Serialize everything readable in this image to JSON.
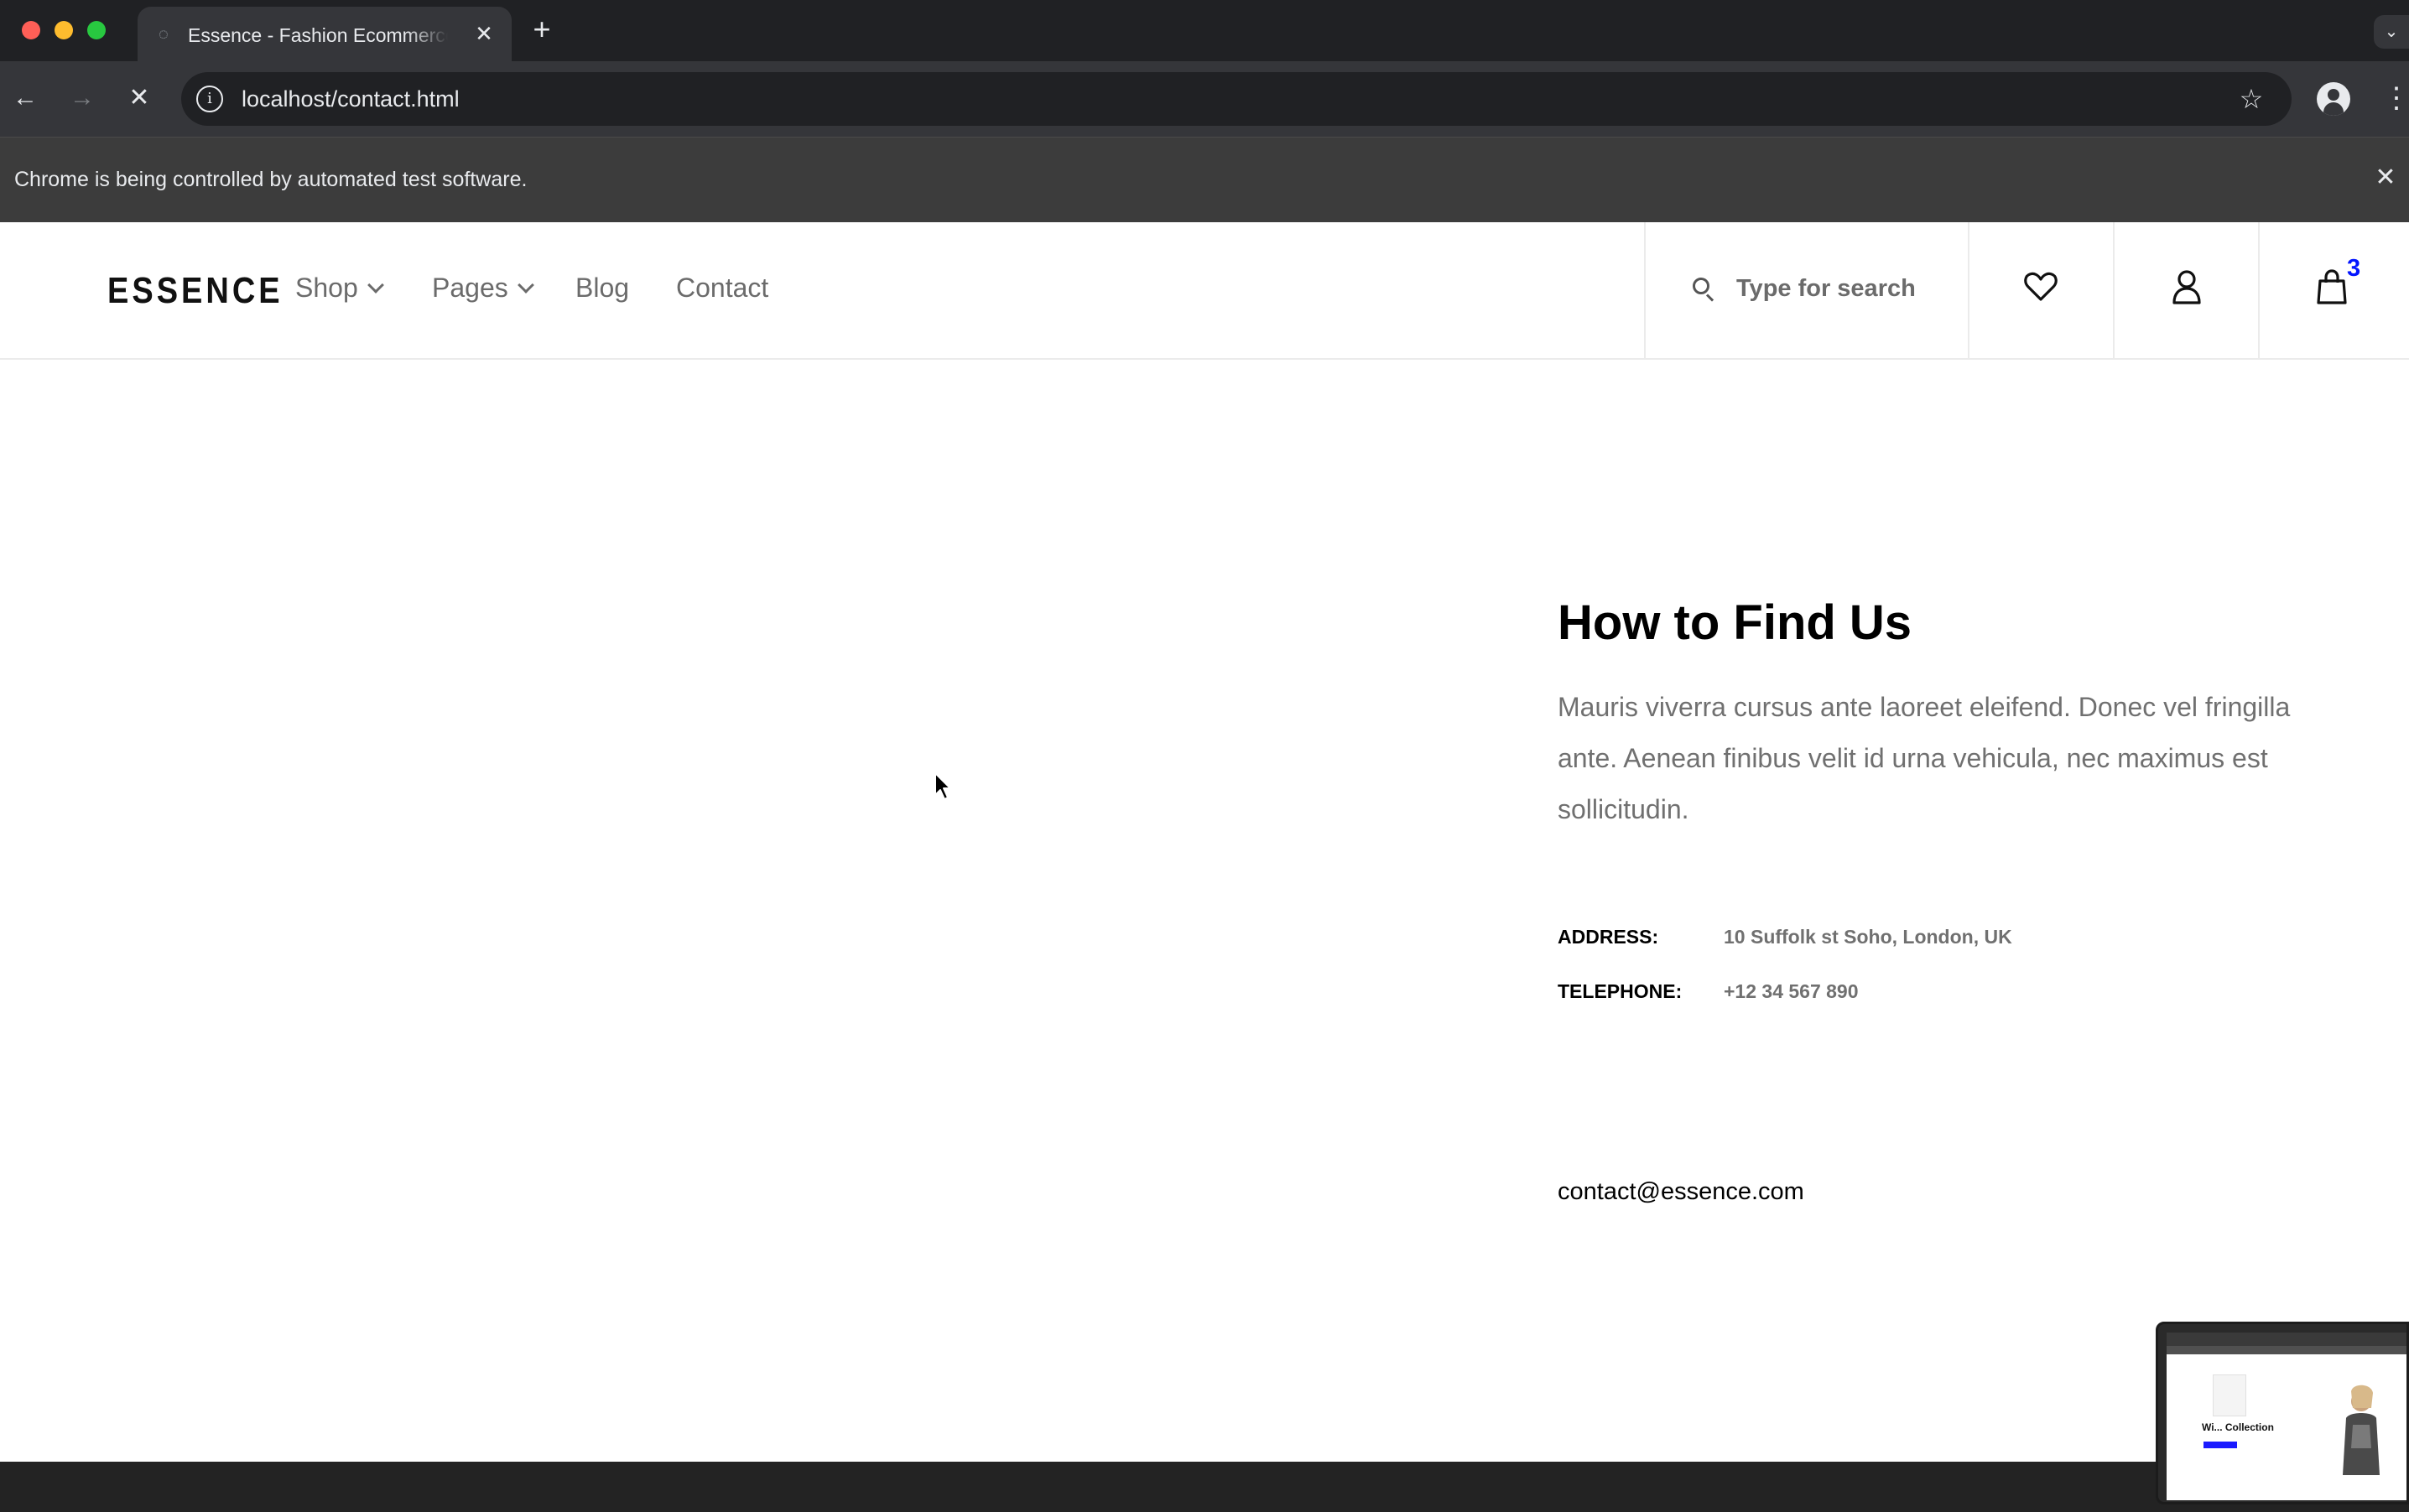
{
  "browser": {
    "tab_title": "Essence - Fashion Ecommerce Template",
    "tab_close_glyph": "✕",
    "new_tab_glyph": "+",
    "url": "localhost/contact.html",
    "site_info_glyph": "i",
    "star_glyph": "☆",
    "menu_glyph": "⋮",
    "back_glyph": "←",
    "forward_glyph": "→",
    "stop_glyph": "✕",
    "tabsearch_glyph": "⌄",
    "infobar_text": "Chrome is being controlled by automated test software.",
    "infobar_close_glyph": "✕"
  },
  "site": {
    "logo": "ESSENCE",
    "nav": {
      "shop": "Shop",
      "pages": "Pages",
      "blog": "Blog",
      "contact": "Contact"
    },
    "search": {
      "placeholder": "Type for search"
    },
    "cart_count": "3",
    "accent_color": "#0315ff"
  },
  "contact": {
    "title": "How to Find Us",
    "description": "Mauris viverra cursus ante laoreet eleifend. Donec vel fringilla ante. Aenean finibus velit id urna vehicula, nec maximus est sollicitudin.",
    "address_label": "ADDRESS:",
    "address_value": "10 Suffolk st Soho, London, UK",
    "telephone_label": "TELEPHONE:",
    "telephone_value": "+12 34 567 890",
    "email": "contact@essence.com"
  },
  "thumbnail": {
    "caption": "Wi... Collection"
  }
}
